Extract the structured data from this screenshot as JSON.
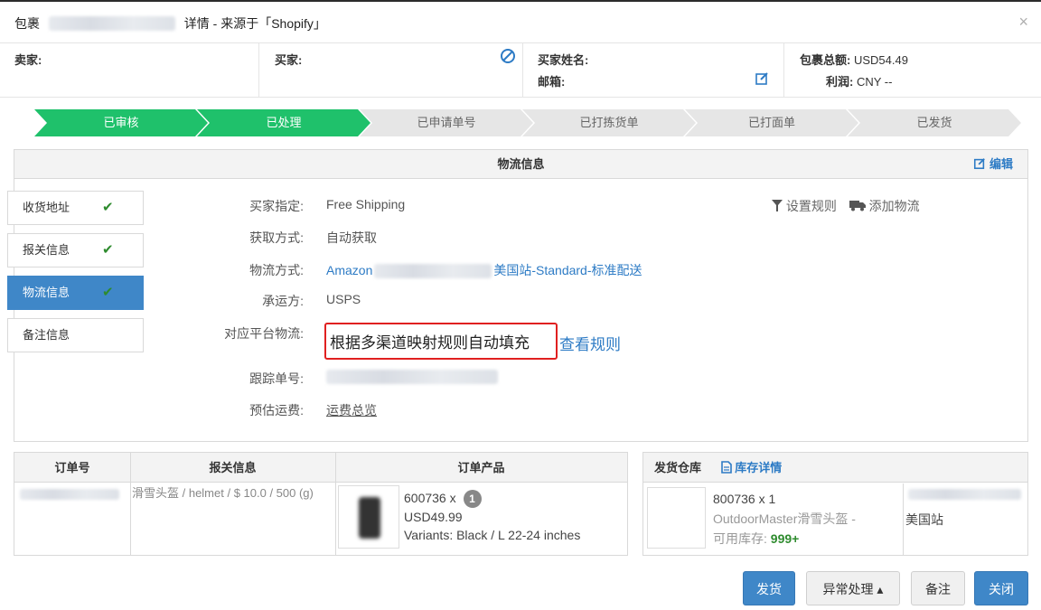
{
  "header": {
    "title_prefix": "包裹",
    "title_suffix": "详情 - 来源于「Shopify」",
    "close": "×"
  },
  "info": {
    "seller_label": "卖家:",
    "buyer_label": "买家:",
    "buyer_name_label": "买家姓名:",
    "email_label": "邮箱:",
    "total_label": "包裹总额:",
    "total_value": "USD54.49",
    "profit_label": "利润:",
    "profit_value": "CNY --"
  },
  "steps": [
    {
      "label": "已审核",
      "state": "done"
    },
    {
      "label": "已处理",
      "state": "done"
    },
    {
      "label": "已申请单号",
      "state": "todo"
    },
    {
      "label": "已打拣货单",
      "state": "todo"
    },
    {
      "label": "已打面单",
      "state": "todo"
    },
    {
      "label": "已发货",
      "state": "todo"
    }
  ],
  "colors": {
    "step_done": "#1fc16b",
    "step_todo": "#e6e6e6",
    "accent": "#3f87c8",
    "link": "#2d7bc5",
    "highlight_border": "#e02020"
  },
  "panel": {
    "title": "物流信息",
    "edit": "编辑",
    "tabs": [
      {
        "label": "收货地址",
        "checked": "✔"
      },
      {
        "label": "报关信息",
        "checked": "✔"
      },
      {
        "label": "物流信息",
        "checked": "✔"
      },
      {
        "label": "备注信息",
        "checked": ""
      }
    ],
    "rule_link": "设置规则",
    "add_logistics": "添加物流",
    "fields": {
      "buyer_assigned_label": "买家指定:",
      "buyer_assigned_value": "Free Shipping",
      "fetch_label": "获取方式:",
      "fetch_value": "自动获取",
      "method_label": "物流方式:",
      "method_prefix": "Amazon",
      "method_suffix": "美国站-Standard-标准配送",
      "carrier_label": "承运方:",
      "carrier_value": "USPS",
      "platform_label": "对应平台物流:",
      "platform_value": "根据多渠道映射规则自动填充",
      "platform_link": "查看规则",
      "tracking_label": "跟踪单号:",
      "freight_label": "预估运费:",
      "freight_value": "运费总览"
    }
  },
  "order_table": {
    "headers": [
      "订单号",
      "报关信息",
      "订单产品"
    ],
    "customs": "滑雪头盔 / helmet / $ 10.0 / 500 (g)",
    "product_sku": "600736 x",
    "product_qty": "1",
    "product_price": "USD49.99",
    "product_variants": "Variants: Black / L 22-24 inches"
  },
  "warehouse_table": {
    "header": "发货仓库",
    "stock_link": "库存详情",
    "sku": "800736 x 1",
    "name": "OutdoorMaster滑雪头盔 -",
    "stock_label": "可用库存:",
    "stock_value": "999+",
    "site": "美国站"
  },
  "buttons": {
    "ship": "发货",
    "exception": "异常处理 ▴",
    "note": "备注",
    "close": "关闭"
  }
}
